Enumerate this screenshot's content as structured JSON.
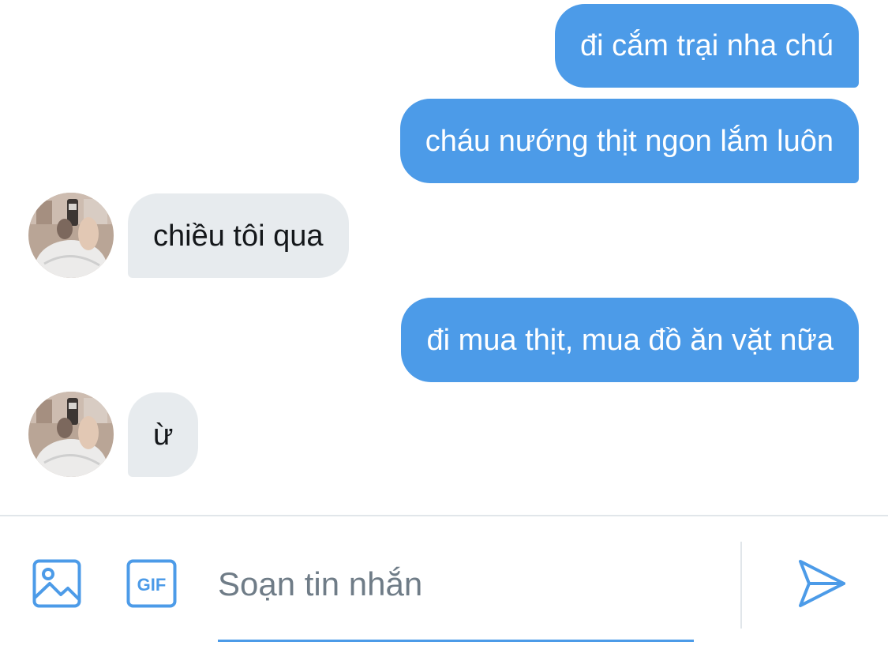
{
  "messages": [
    {
      "side": "sent",
      "text": "đi cắm trại nha chú"
    },
    {
      "side": "sent",
      "text": "cháu nướng thịt ngon lắm luôn"
    },
    {
      "side": "received",
      "text": "chiều tôi qua"
    },
    {
      "side": "sent",
      "text": "đi mua thịt, mua đồ ăn vặt nữa"
    },
    {
      "side": "received",
      "text": "ừ"
    }
  ],
  "composer": {
    "placeholder": "Soạn tin nhắn",
    "value": "",
    "gif_label": "GIF",
    "icons": {
      "image": "image-icon",
      "gif": "gif-icon",
      "send": "send-icon"
    }
  },
  "colors": {
    "accent": "#4c9be8",
    "received_bubble": "#e7ebee",
    "background": "#ffffff"
  }
}
